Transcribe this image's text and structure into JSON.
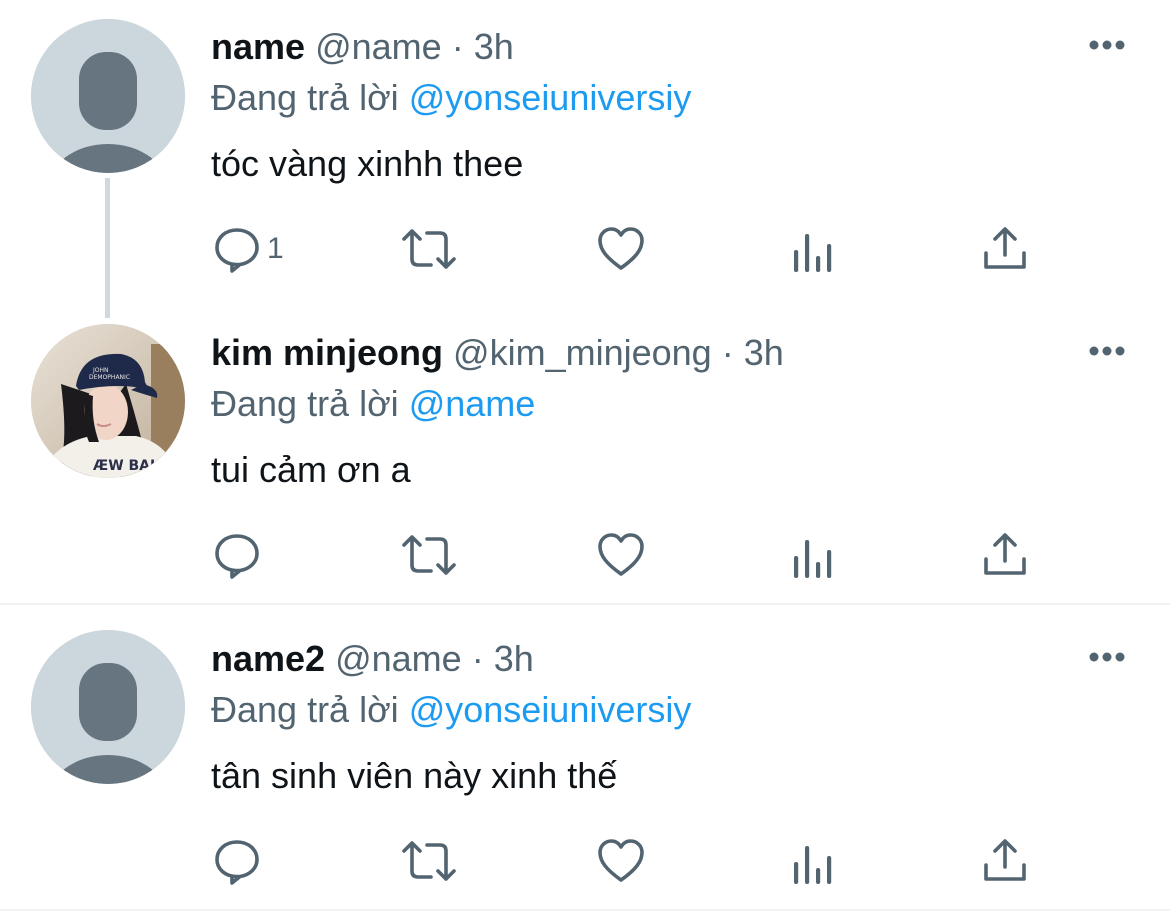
{
  "tweets": [
    {
      "display_name": "name",
      "handle": "@name",
      "separator": "·",
      "time": "3h",
      "reply_prefix": "Đang trả lời",
      "reply_to": "@yonseiuniversiy",
      "text": "tóc vàng xinhh thee",
      "reply_count": "1",
      "avatar": "default-avatar"
    },
    {
      "display_name": "kim minjeong",
      "handle": "@kim_minjeong",
      "separator": "·",
      "time": "3h",
      "reply_prefix": "Đang trả lời",
      "reply_to": "@name",
      "text": "tui cảm ơn a",
      "reply_count": "",
      "avatar": "photo-avatar"
    },
    {
      "display_name": "name2",
      "handle": "@name",
      "separator": "·",
      "time": "3h",
      "reply_prefix": "Đang trả lời",
      "reply_to": "@yonseiuniversiy",
      "text": "tân sinh viên này xinh thế",
      "reply_count": "",
      "avatar": "default-avatar"
    }
  ],
  "colors": {
    "accent": "#1d9bf0",
    "secondary_text": "#536471",
    "primary_text": "#0f1419",
    "avatar_bg": "#ccd6dd",
    "avatar_fg": "#66757f",
    "divider": "#eff3f4",
    "thread_line": "#cfd9de"
  },
  "icons": {
    "reply": "reply-icon",
    "retweet": "retweet-icon",
    "like": "heart-icon",
    "analytics": "analytics-icon",
    "share": "share-icon",
    "more": "more-icon"
  }
}
